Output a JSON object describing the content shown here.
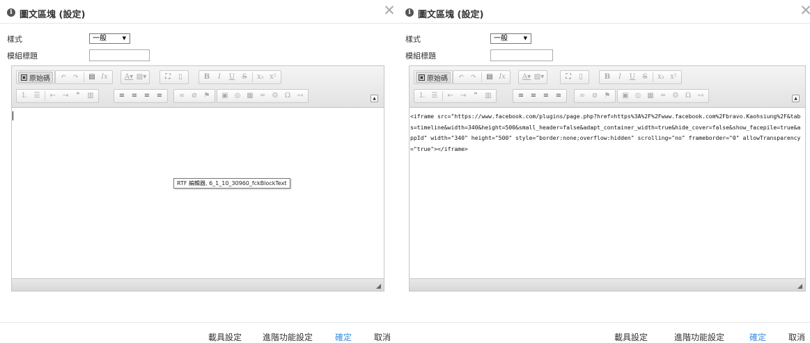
{
  "left_dialog": {
    "title": "圖文區塊 (設定)",
    "style_label": "樣式",
    "style_value": "一般",
    "module_title_label": "模組標題",
    "module_title_value": "",
    "tooltip": "RTF 編輯器, 6_1_10_30960_fckBlockText",
    "editor_content": "",
    "footer": {
      "carrier_settings": "載具設定",
      "advanced_settings": "進階功能設定",
      "confirm": "確定",
      "cancel": "取消"
    }
  },
  "right_dialog": {
    "title": "圖文區塊 (設定)",
    "style_label": "樣式",
    "style_value": "一般",
    "module_title_label": "模組標題",
    "module_title_value": "",
    "editor_content": "<iframe src=\"https://www.facebook.com/plugins/page.php?href=https%3A%2F%2Fwww.facebook.com%2Fbravo.Kaohsiung%2F&tabs=timeline&width=340&height=500&small_header=false&adapt_container_width=true&hide_cover=false&show_facepile=true&appId\" width=\"340\" height=\"500\" style=\"border:none;overflow:hidden\" scrolling=\"no\" frameborder=\"0\" allowTransparency=\"true\"></iframe>",
    "footer": {
      "carrier_settings": "載具設定",
      "advanced_settings": "進階功能設定",
      "confirm": "確定",
      "cancel": "取消"
    }
  },
  "toolbar": {
    "source_label": "原始碼",
    "icons_row1": [
      "undo-icon",
      "redo-icon",
      "paste-from-word-icon",
      "remove-format-icon",
      "text-color-icon",
      "background-color-icon",
      "maximize-icon",
      "show-blocks-icon",
      "bold-icon",
      "italic-icon",
      "underline-icon",
      "strikethrough-icon",
      "subscript-icon",
      "superscript-icon"
    ],
    "icons_row2": [
      "numbered-list-icon",
      "bulleted-list-icon",
      "outdent-icon",
      "indent-icon",
      "blockquote-icon",
      "div-container-icon",
      "align-left-icon",
      "align-center-icon",
      "align-right-icon",
      "justify-icon",
      "link-icon",
      "unlink-icon",
      "anchor-icon",
      "image-icon",
      "flash-icon",
      "table-icon",
      "horizontal-line-icon",
      "smiley-icon",
      "special-char-icon",
      "page-break-icon"
    ],
    "glyphs": {
      "undo": "↶",
      "redo": "↷",
      "paste": "▤",
      "clear": "Ix",
      "textcolor": "A▾",
      "bgcolor": "▨▾",
      "maximize": "⛶",
      "blocks": "▯",
      "bold": "B",
      "italic": "I",
      "underline": "U",
      "strike": "S",
      "sub": "x₂",
      "sup": "x²",
      "ol": "⒈",
      "ul": "☰",
      "outdent": "⇤",
      "indent": "⇥",
      "quote": "❞",
      "div": "▥",
      "alignleft": "≡",
      "aligncenter": "≡",
      "alignright": "≡",
      "justify": "≡",
      "link": "∞",
      "unlink": "⊘",
      "anchor": "⚑",
      "image": "▣",
      "flash": "◎",
      "table": "▦",
      "hr": "═",
      "smiley": "☺",
      "omega": "Ω",
      "pagebreak": "↤"
    },
    "collapse_glyph": "▲"
  }
}
